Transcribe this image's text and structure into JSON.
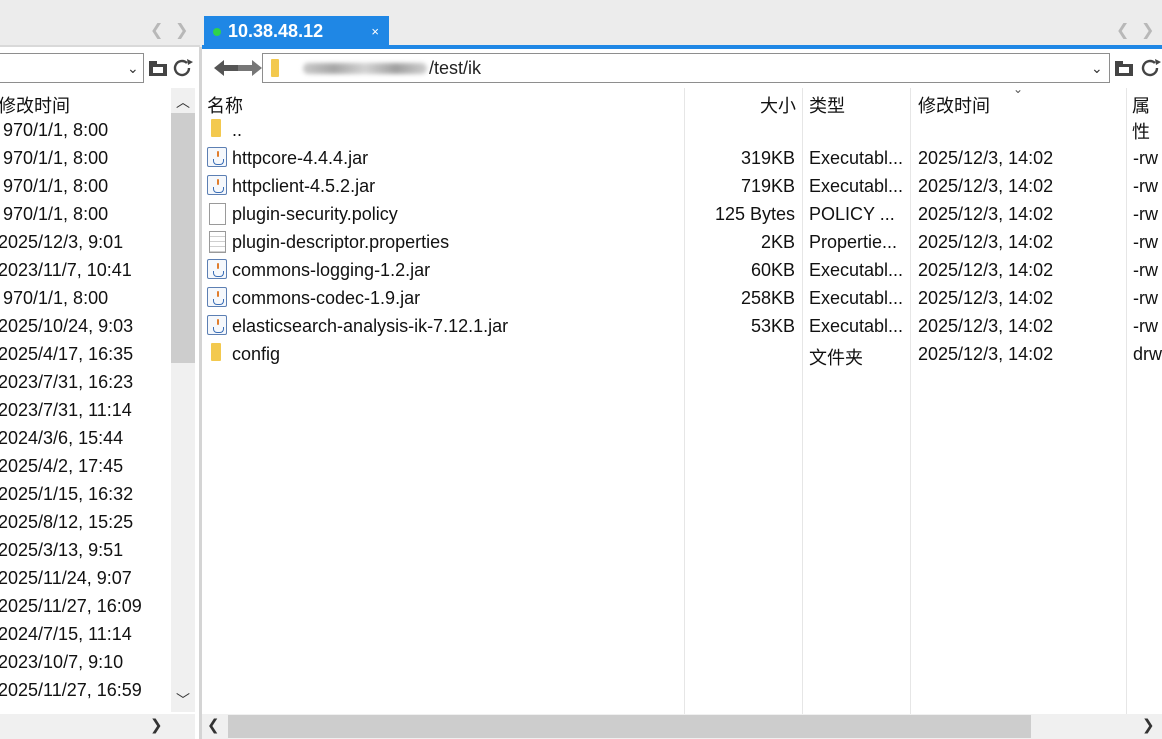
{
  "tabs": {
    "active_title": "10.38.48.12",
    "close_glyph": "×"
  },
  "left_panel": {
    "header_modified": "修改时间",
    "dates": [
      "970/1/1, 8:00",
      "970/1/1, 8:00",
      "970/1/1, 8:00",
      "970/1/1, 8:00",
      "2025/12/3, 9:01",
      "2023/11/7, 10:41",
      "970/1/1, 8:00",
      "2025/10/24, 9:03",
      "2025/4/17, 16:35",
      "2023/7/31, 16:23",
      "2023/7/31, 11:14",
      "2024/3/6, 15:44",
      "2025/4/2, 17:45",
      "2025/1/15, 16:32",
      "2025/8/12, 15:25",
      "2025/3/13, 9:51",
      "2025/11/24, 9:07",
      "2025/11/27, 16:09",
      "2024/7/15, 11:14",
      "2023/10/7, 9:10",
      "2025/11/27, 16:59"
    ]
  },
  "right_panel": {
    "path_suffix": "/test/ik",
    "headers": {
      "name": "名称",
      "size": "大小",
      "type": "类型",
      "modified": "修改时间",
      "attributes": "属性"
    },
    "files": [
      {
        "name": "..",
        "size": "",
        "type": "",
        "modified": "",
        "attr": "",
        "icon": "folder-icon"
      },
      {
        "name": "httpcore-4.4.4.jar",
        "size": "319KB",
        "type": "Executabl...",
        "modified": "2025/12/3, 14:02",
        "attr": "-rw",
        "icon": "jar-icon"
      },
      {
        "name": "httpclient-4.5.2.jar",
        "size": "719KB",
        "type": "Executabl...",
        "modified": "2025/12/3, 14:02",
        "attr": "-rw",
        "icon": "jar-icon"
      },
      {
        "name": "plugin-security.policy",
        "size": "125 Bytes",
        "type": "POLICY ...",
        "modified": "2025/12/3, 14:02",
        "attr": "-rw",
        "icon": "document-icon"
      },
      {
        "name": "plugin-descriptor.properties",
        "size": "2KB",
        "type": "Propertie...",
        "modified": "2025/12/3, 14:02",
        "attr": "-rw",
        "icon": "properties-file-icon"
      },
      {
        "name": "commons-logging-1.2.jar",
        "size": "60KB",
        "type": "Executabl...",
        "modified": "2025/12/3, 14:02",
        "attr": "-rw",
        "icon": "jar-icon"
      },
      {
        "name": "commons-codec-1.9.jar",
        "size": "258KB",
        "type": "Executabl...",
        "modified": "2025/12/3, 14:02",
        "attr": "-rw",
        "icon": "jar-icon"
      },
      {
        "name": "elasticsearch-analysis-ik-7.12.1.jar",
        "size": "53KB",
        "type": "Executabl...",
        "modified": "2025/12/3, 14:02",
        "attr": "-rw",
        "icon": "jar-icon"
      },
      {
        "name": "config",
        "size": "",
        "type": "文件夹",
        "modified": "2025/12/3, 14:02",
        "attr": "drw",
        "icon": "folder-icon"
      }
    ]
  },
  "colors": {
    "tab_active": "#1f87e5",
    "tab_dot": "#2fd24a",
    "folder": "#f3c94e"
  }
}
